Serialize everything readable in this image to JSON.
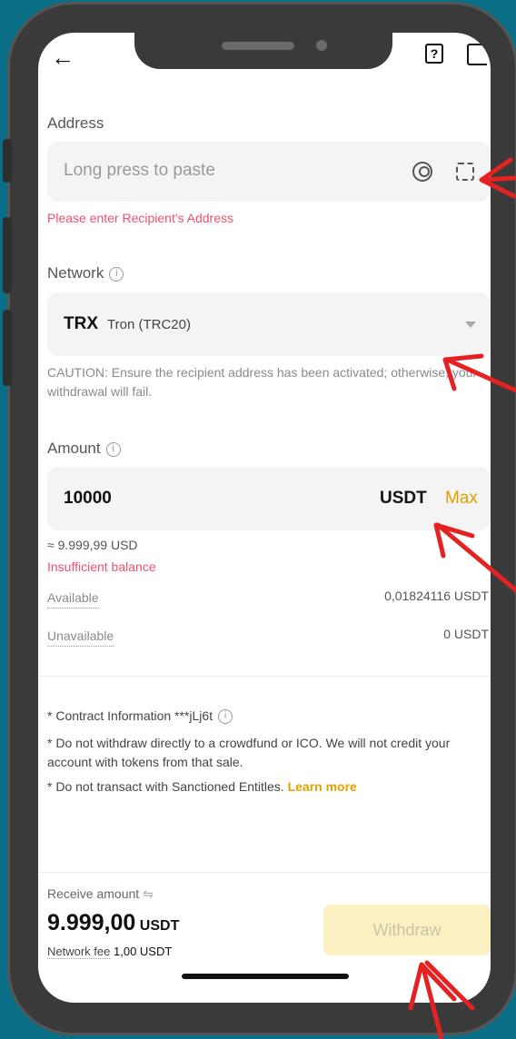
{
  "header": {
    "back_icon": "arrow-left-icon",
    "help_icon": "help-icon",
    "history_icon": "history-icon"
  },
  "address": {
    "label": "Address",
    "placeholder": "Long press to paste",
    "error": "Please enter Recipient's Address"
  },
  "network": {
    "label": "Network",
    "symbol": "TRX",
    "name": "Tron (TRC20)",
    "caution": "CAUTION: Ensure the recipient address has been activated; otherwise, your withdrawal will fail."
  },
  "amount": {
    "label": "Amount",
    "value": "10000",
    "currency": "USDT",
    "max_label": "Max",
    "approx": "≈ 9.999,99 USD",
    "error": "Insufficient balance"
  },
  "balances": [
    {
      "label": "Available",
      "value": "0,01824116 USDT"
    },
    {
      "label": "Unavailable",
      "value": "0 USDT"
    }
  ],
  "notes": {
    "contract": "* Contract Information ***jLj6t",
    "crowdfund": "* Do not withdraw directly to a crowdfund or ICO. We will not credit your account with tokens from that sale.",
    "sanctioned": "* Do not transact with Sanctioned Entitles.",
    "learn_more": "Learn more"
  },
  "footer": {
    "receive_label": "Receive amount",
    "receive_value": "9.999,00",
    "receive_unit": "USDT",
    "fee_label": "Network fee",
    "fee_value": "1,00 USDT",
    "withdraw_label": "Withdraw"
  },
  "colors": {
    "accent": "#e0a100",
    "error": "#f0506e",
    "annotation": "#e52222",
    "background": "#0b6f87"
  }
}
